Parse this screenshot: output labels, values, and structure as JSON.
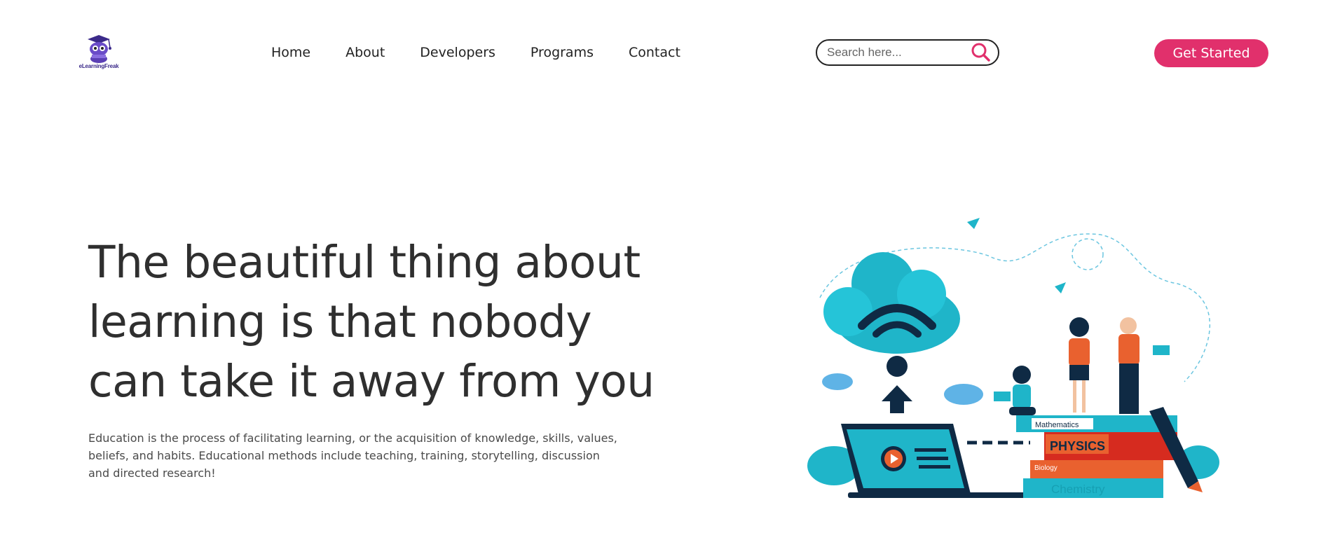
{
  "header": {
    "logo_text": "eLearningFreak",
    "nav": [
      {
        "label": "Home"
      },
      {
        "label": "About"
      },
      {
        "label": "Developers"
      },
      {
        "label": "Programs"
      },
      {
        "label": "Contact"
      }
    ],
    "search": {
      "placeholder": "Search here...",
      "value": ""
    },
    "cta_label": "Get Started"
  },
  "hero": {
    "title": "The beautiful thing about learning is that nobody can take it away from you",
    "description": "Education is the process of facilitating learning, or the acquisition of knowledge, skills, values, beliefs, and habits. Educational methods include teaching, training, storytelling, discussion and directed research!"
  },
  "illustration": {
    "books": [
      "Mathematics",
      "PHYSICS",
      "Biology",
      "Chemistry"
    ]
  },
  "colors": {
    "accent": "#e1306c",
    "teal": "#1fb5c9",
    "navy": "#0f2a44",
    "logo_purple": "#5b3fb5"
  }
}
